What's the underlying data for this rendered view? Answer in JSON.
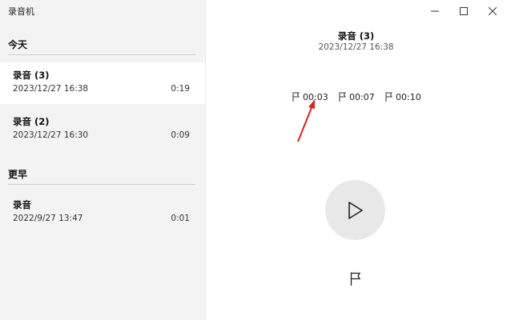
{
  "app": {
    "title": "录音机"
  },
  "window_controls": {
    "minimize_icon": "minimize-icon",
    "maximize_icon": "maximize-icon",
    "close_icon": "close-icon"
  },
  "recordings": {
    "groups": [
      {
        "header": "今天",
        "items": [
          {
            "name": "录音 (3)",
            "date": "2023/12/27 16:38",
            "duration": "0:19",
            "selected": true
          },
          {
            "name": "录音 (2)",
            "date": "2023/12/27 16:30",
            "duration": "0:09",
            "selected": false
          }
        ]
      },
      {
        "header": "更早",
        "items": [
          {
            "name": "录音",
            "date": "2022/9/27 13:47",
            "duration": "0:01",
            "selected": false
          }
        ]
      }
    ]
  },
  "detail": {
    "title": "录音 (3)",
    "date": "2023/12/27 16:38",
    "markers": [
      "00:03",
      "00:07",
      "00:10"
    ],
    "play_icon": "play-icon",
    "add_marker_icon": "flag-icon"
  },
  "annotation": {
    "arrow_color": "#e02020"
  }
}
